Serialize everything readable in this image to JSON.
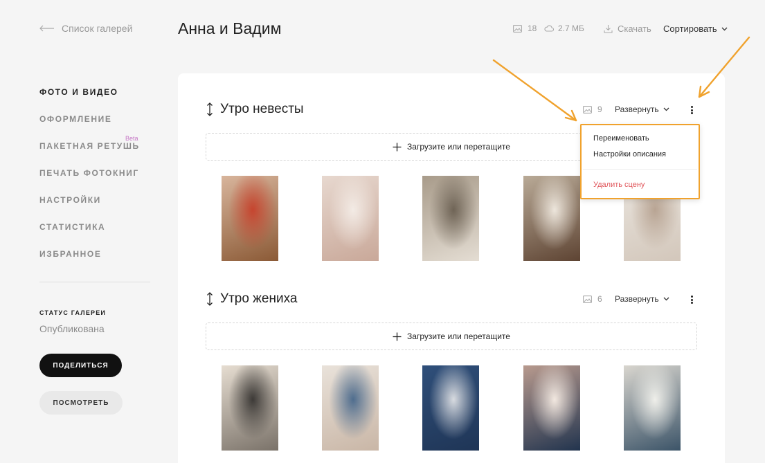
{
  "header": {
    "back_label": "Список галерей",
    "title": "Анна и Вадим",
    "photo_count": "18",
    "storage_size": "2.7 МБ",
    "download_label": "Скачать",
    "sort_label": "Сортировать"
  },
  "sidebar": {
    "items": [
      {
        "label": "ФОТО И ВИДЕО",
        "active": true
      },
      {
        "label": "ОФОРМЛЕНИЕ"
      },
      {
        "label": "ПАКЕТНАЯ РЕТУШЬ",
        "badge": "Beta"
      },
      {
        "label": "ПЕЧАТЬ ФОТОКНИГ"
      },
      {
        "label": "НАСТРОЙКИ"
      },
      {
        "label": "СТАТИСТИКА"
      },
      {
        "label": "ИЗБРАННОЕ"
      }
    ],
    "status_label": "СТАТУС ГАЛЕРЕИ",
    "status_value": "Опубликована",
    "share_button": "ПОДЕЛИТЬСЯ",
    "view_button": "ПОСМОТРЕТЬ"
  },
  "scenes": [
    {
      "title": "Утро невесты",
      "count": "9",
      "expand_label": "Развернуть",
      "upload_label": "Загрузите или перетащите",
      "photos": [
        {
          "icon": "mirror-shoes-photo",
          "colors": [
            "#d8b59c",
            "#8b5a36",
            "#c6452f"
          ]
        },
        {
          "icon": "lace-dress-back-photo",
          "colors": [
            "#e7d8cf",
            "#c9a899",
            "#f3ebe5"
          ]
        },
        {
          "icon": "bride-portrait-window-photo",
          "colors": [
            "#a89b8a",
            "#e4ddd3",
            "#6f6456"
          ]
        },
        {
          "icon": "bride-profile-photo",
          "colors": [
            "#b9aa97",
            "#5e4433",
            "#ede6dc"
          ]
        },
        {
          "icon": "dress-buttons-photo",
          "colors": [
            "#e9e4dd",
            "#d3c7bb",
            "#b8a493"
          ]
        }
      ]
    },
    {
      "title": "Утро жениха",
      "count": "6",
      "expand_label": "Развернуть",
      "upload_label": "Загрузите или перетащите",
      "photos": [
        {
          "icon": "groom-vest-photo",
          "colors": [
            "#e6ddd1",
            "#7a7269",
            "#3d3a37"
          ]
        },
        {
          "icon": "hands-cufflink-photo",
          "colors": [
            "#e9e2da",
            "#c9b6a6",
            "#4f6d8e"
          ]
        },
        {
          "icon": "blue-suit-tie-photo",
          "colors": [
            "#2f4f7a",
            "#1f3556",
            "#d8dbe0"
          ]
        },
        {
          "icon": "suit-buttons-photo",
          "colors": [
            "#b89a8e",
            "#22344e",
            "#f2e8e0"
          ]
        },
        {
          "icon": "groom-mirror-photo",
          "colors": [
            "#d9d6cf",
            "#3c5468",
            "#efefea"
          ]
        }
      ]
    }
  ],
  "menu": {
    "rename": "Переименовать",
    "description_settings": "Настройки описания",
    "delete_scene": "Удалить сцену"
  },
  "colors": {
    "accent_highlight": "#f0a22d",
    "danger": "#e0565b",
    "beta_badge": "#c678c6",
    "primary_button": "#111111"
  }
}
